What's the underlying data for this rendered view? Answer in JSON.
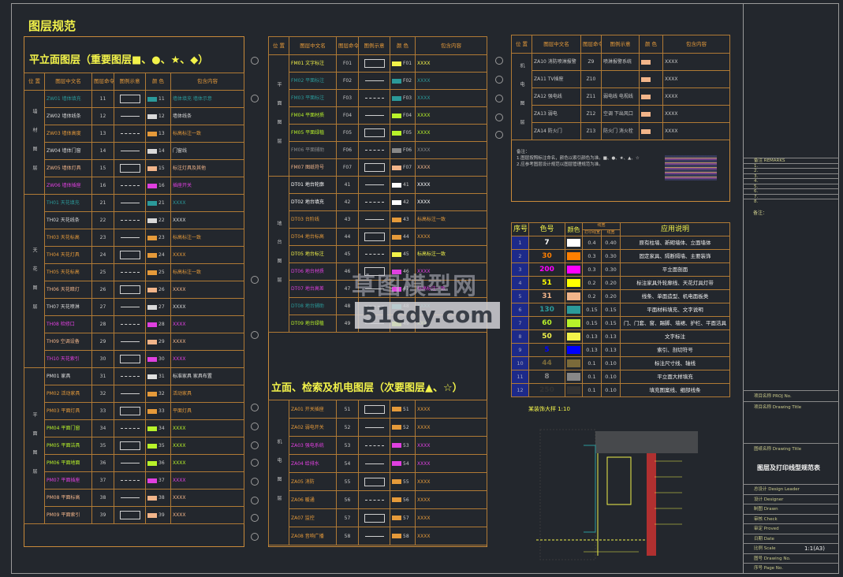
{
  "page_title": "图层规范",
  "panel1": {
    "title": "平立面图层（重要图层■、●、★、◆）",
    "headers": [
      "位 置",
      "图层中文名",
      "图层命令",
      "图例示意",
      "颜 色",
      "包含内容"
    ],
    "groups": [
      {
        "label": "墙 材 图 层",
        "rows": [
          {
            "name": "ZW01 墙体填充",
            "code": "11",
            "color": "#2b9a9a",
            "num": "",
            "content": "墙体填充  墙体示意"
          },
          {
            "name": "ZW02 墙体线条",
            "code": "12",
            "color": "#d9d9d9",
            "num": "",
            "content": "墙体线条"
          },
          {
            "name": "ZW03 墙体高度",
            "code": "13",
            "color": "#e59a3a",
            "num": "",
            "content": "标高标注一致"
          },
          {
            "name": "ZW04 墙体门窗",
            "code": "14",
            "color": "#d9d9d9",
            "num": "",
            "content": "门窗线"
          },
          {
            "name": "ZW05 墙体灯具",
            "code": "15",
            "color": "#f2b58a",
            "num": "",
            "content": "标注灯具及其他"
          },
          {
            "name": "ZW06 墙体插座",
            "code": "16",
            "color": "#e040e0",
            "num": "",
            "content": "插座开关"
          }
        ]
      },
      {
        "label": "天 花 图 层",
        "rows": [
          {
            "name": "TH01 天花填充",
            "code": "21",
            "color": "#2b9a9a",
            "num": "",
            "content": "XXXX"
          },
          {
            "name": "TH02 天花线条",
            "code": "22",
            "color": "#d9d9d9",
            "num": "",
            "content": "XXXX"
          },
          {
            "name": "TH03 天花标高",
            "code": "23",
            "color": "#e59a3a",
            "num": "",
            "content": "标高标注一致"
          },
          {
            "name": "TH04 天花灯具",
            "code": "24",
            "color": "#e59a3a",
            "num": "",
            "content": "XXXX"
          },
          {
            "name": "TH05 天花标高",
            "code": "25",
            "color": "#e59a3a",
            "num": "",
            "content": "标高标注一致"
          },
          {
            "name": "TH06 天花暗灯",
            "code": "26",
            "color": "#f2b58a",
            "num": "",
            "content": "XXXX"
          },
          {
            "name": "TH07 天花喷淋",
            "code": "27",
            "color": "#d9d9d9",
            "num": "",
            "content": "XXXX"
          },
          {
            "name": "TH08 检修口",
            "code": "28",
            "color": "#e040e0",
            "num": "",
            "content": "XXXX"
          },
          {
            "name": "TH09 空调设备",
            "code": "29",
            "color": "#f2b58a",
            "num": "",
            "content": "XXXX"
          },
          {
            "name": "TH10 天花索引",
            "code": "30",
            "color": "#e040e0",
            "num": "",
            "content": "XXXX"
          }
        ]
      },
      {
        "label": "平 面 图 层",
        "rows": [
          {
            "name": "PM01 家具",
            "code": "31",
            "color": "#e0e0e0",
            "num": "",
            "content": "标准家具  家具布置"
          },
          {
            "name": "PM02 活动家具",
            "code": "32",
            "color": "#e59a3a",
            "num": "",
            "content": "活动家具"
          },
          {
            "name": "PM03 平面灯具",
            "code": "33",
            "color": "#e59a3a",
            "num": "",
            "content": "平面灯具"
          },
          {
            "name": "PM04 平面门窗",
            "code": "34",
            "color": "#b8f22a",
            "num": "",
            "content": "XXXX"
          },
          {
            "name": "PM05 平面洁具",
            "code": "35",
            "color": "#b8f22a",
            "num": "",
            "content": "XXXX"
          },
          {
            "name": "PM06 平面地面",
            "code": "36",
            "color": "#b8f22a",
            "num": "",
            "content": "XXXX"
          },
          {
            "name": "PM07 平面插座",
            "code": "37",
            "color": "#e040e0",
            "num": "",
            "content": "XXXX"
          },
          {
            "name": "PM08 平面标高",
            "code": "38",
            "color": "#f2b58a",
            "num": "",
            "content": "XXXX"
          },
          {
            "name": "PM09 平面索引",
            "code": "39",
            "color": "#f2b58a",
            "num": "",
            "content": "XXXX"
          }
        ]
      }
    ]
  },
  "panel2": {
    "headers": [
      "位 置",
      "图层中文名",
      "图层命令",
      "图例示意",
      "颜 色",
      "包含内容"
    ],
    "groups": [
      {
        "label": "平 面 图 层",
        "rows": [
          {
            "name": "FM01 文字标注",
            "code": "F01",
            "color": "#f2f24a",
            "content": "XXXX"
          },
          {
            "name": "FM02 平面标注",
            "code": "F02",
            "color": "#2b9a9a",
            "content": "XXXX"
          },
          {
            "name": "FM03 平面标注",
            "code": "F03",
            "color": "#2b9a9a",
            "content": "XXXX"
          },
          {
            "name": "FM04 平面材质",
            "code": "F04",
            "color": "#b8f22a",
            "content": "XXXX"
          },
          {
            "name": "FM05 平面绿植",
            "code": "F05",
            "color": "#b8f22a",
            "content": "XXXX"
          },
          {
            "name": "FM06 平面辅助",
            "code": "F06",
            "color": "#888888",
            "content": "XXXX"
          },
          {
            "name": "FM07 图纸符号",
            "code": "F07",
            "color": "#f2b58a",
            "content": "XXXX"
          }
        ]
      },
      {
        "label": "地 台 图 层",
        "rows": [
          {
            "name": "DT01 地台轮廓",
            "code": "41",
            "color": "#ffffff",
            "content": "XXXX"
          },
          {
            "name": "DT02 地台填充",
            "code": "42",
            "color": "#ffffff",
            "content": "XXXX"
          },
          {
            "name": "DT03 台阶线",
            "code": "43",
            "color": "#e59a3a",
            "content": "标高标注一致"
          },
          {
            "name": "DT04 地台标高",
            "code": "44",
            "color": "#e59a3a",
            "content": "XXXX"
          },
          {
            "name": "DT05 地台标注",
            "code": "45",
            "color": "#f2f24a",
            "content": "标高标注一致"
          },
          {
            "name": "DT06 地台材质",
            "code": "46",
            "color": "#e040e0",
            "content": "XXXX"
          },
          {
            "name": "DT07 地台高差",
            "code": "47",
            "color": "#e040e0",
            "content": "标高标注一致"
          },
          {
            "name": "DT08 地台辅助",
            "code": "48",
            "color": "#2b9a9a",
            "content": "XXXX"
          },
          {
            "name": "DT09 地台绿植",
            "code": "49",
            "color": "#b8f22a",
            "content": "XXXX"
          }
        ]
      }
    ],
    "subtitle": "立面、检索及机电图层（次要图层▲、☆）",
    "groups2": [
      {
        "label": "机 电 图 层",
        "rows": [
          {
            "name": "ZA01 开关插座",
            "code": "51",
            "color": "#e59a3a",
            "content": "XXXX"
          },
          {
            "name": "ZA02 弱电开关",
            "code": "52",
            "color": "#e59a3a",
            "content": "XXXX"
          },
          {
            "name": "ZA03 强电系统",
            "code": "53",
            "color": "#e040e0",
            "content": "XXXX"
          },
          {
            "name": "ZA04 给排水",
            "code": "54",
            "color": "#e040e0",
            "content": "XXXX"
          },
          {
            "name": "ZA05 消防",
            "code": "55",
            "color": "#e59a3a",
            "content": "XXXX"
          },
          {
            "name": "ZA06 暖通",
            "code": "56",
            "color": "#e59a3a",
            "content": "XXXX"
          },
          {
            "name": "ZA07 监控",
            "code": "57",
            "color": "#e59a3a",
            "content": "XXXX"
          },
          {
            "name": "ZA08 音响广播",
            "code": "58",
            "color": "#e59a3a",
            "content": "XXXX"
          }
        ]
      }
    ]
  },
  "panel3": {
    "headers": [
      "位 置",
      "图层中文名",
      "图层命令",
      "图例示意",
      "颜 色",
      "包含内容"
    ],
    "label": "机 电 图 层",
    "rows": [
      {
        "name": "ZA10 消防喷淋报警",
        "code": "Z9",
        "color": "#f2b58a",
        "legend": "喷淋报警系统",
        "content": "XXXX"
      },
      {
        "name": "ZA11 TV插座",
        "code": "Z10",
        "color": "#f2b58a",
        "legend": "",
        "content": "XXXX"
      },
      {
        "name": "ZA12 强电线",
        "code": "Z11",
        "color": "#f2b58a",
        "legend": "弱电线 电视线",
        "content": "XXXX"
      },
      {
        "name": "ZA13 弱电",
        "code": "Z12",
        "color": "#f2b58a",
        "legend": "空调 下出风口",
        "content": "XXXX"
      },
      {
        "name": "ZA14 防火门",
        "code": "Z13",
        "color": "#f2b58a",
        "legend": "防火门 消火栓",
        "content": "XXXX"
      }
    ],
    "note": "备注：\n1.图层按照标注命名，颜色以索引颜色为准。■、●、★、▲、☆\n2.应参考图层设计规范以图层管理规范为准。"
  },
  "color_table": {
    "headers": [
      "序号",
      "色号",
      "颜色",
      "线宽",
      "应用说明"
    ],
    "subheaders": [
      "打印线宽",
      "线宽"
    ],
    "rows": [
      {
        "n": "1",
        "code": "7",
        "hex": "#ffffff",
        "w1": "0.4",
        "w2": "0.40",
        "desc": "原有柱墙、新砌墙体、立面墙体"
      },
      {
        "n": "2",
        "code": "30",
        "hex": "#ff7f00",
        "w1": "0.3",
        "w2": "0.30",
        "desc": "固定家具、隔断隔墙、主要装饰"
      },
      {
        "n": "3",
        "code": "200",
        "hex": "#ff00ff",
        "w1": "0.3",
        "w2": "0.30",
        "desc": "平立面剖面"
      },
      {
        "n": "4",
        "code": "51",
        "hex": "#ffff00",
        "w1": "0.2",
        "w2": "0.20",
        "desc": "标注家具外轮廓线、天花灯具灯带"
      },
      {
        "n": "5",
        "code": "31",
        "hex": "#f2b58a",
        "w1": "0.2",
        "w2": "0.20",
        "desc": "线条、单面造型、机电面板类"
      },
      {
        "n": "6",
        "code": "130",
        "hex": "#2b9a9a",
        "w1": "0.15",
        "w2": "0.15",
        "desc": "平面材料填充、文字说明"
      },
      {
        "n": "7",
        "code": "60",
        "hex": "#b8f22a",
        "w1": "0.15",
        "w2": "0.15",
        "desc": "门、门套、窗、踢脚、墙裙、护栏、平面洁具"
      },
      {
        "n": "8",
        "code": "50",
        "hex": "#f2f24a",
        "w1": "0.13",
        "w2": "0.13",
        "desc": "文字标注"
      },
      {
        "n": "9",
        "code": "5",
        "hex": "#0000ff",
        "w1": "0.13",
        "w2": "0.13",
        "desc": "索引、剖切符号"
      },
      {
        "n": "10",
        "code": "44",
        "hex": "#7a6a3a",
        "w1": "0.1",
        "w2": "0.10",
        "desc": "标注尺寸线、轴线"
      },
      {
        "n": "11",
        "code": "8",
        "hex": "#888888",
        "w1": "0.1",
        "w2": "0.10",
        "desc": "平立面大样填充"
      },
      {
        "n": "12",
        "code": "250",
        "hex": "#333333",
        "w1": "0.1",
        "w2": "0.10",
        "desc": "填充图案线、细部线条"
      }
    ]
  },
  "detail": {
    "label": "某装饰大样 1:10"
  },
  "right_panel": {
    "rows_top": [
      "备注 REMARKS",
      "1.",
      "2.",
      "3.",
      "4.",
      "5.",
      "6.",
      "7.",
      "8."
    ],
    "note_label": "备注：",
    "project": "项目名称 PROJ No.",
    "drawing_title": "项目名称 Drawing Title",
    "drawing_name_label": "图纸名称 Drawing Title",
    "drawing_name": "图层及打印线型规范表",
    "signs": [
      "总设计 Design Leader",
      "设计 Designer",
      "制图 Drawn",
      "审核 Check",
      "审定 Proved",
      "日期 Date",
      "比例 Scale",
      "图号 Drawing No.",
      "序号 Page No."
    ],
    "scale": "1:1(A3)"
  },
  "watermark": {
    "line1": "草图模型网",
    "line2": "51cdy.com"
  }
}
